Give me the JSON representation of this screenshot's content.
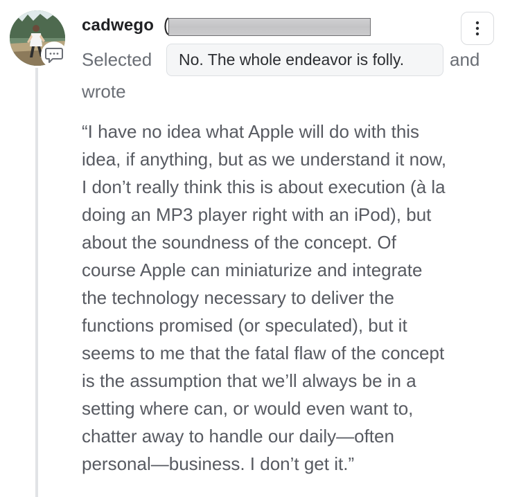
{
  "comment": {
    "username": "cadwego",
    "selected_prefix": "Selected",
    "selected_option": "No. The whole endeavor is folly.",
    "and_text": "and",
    "wrote_text": "wrote",
    "quote_lines": [
      "“I have no idea what Apple will do with this",
      "idea, if anything, but as we understand it now,",
      "I don’t really think this is about execution (à la",
      "doing an MP3 player right with an iPod), but",
      "about the soundness of the concept. Of",
      "course Apple can miniaturize and integrate",
      "the technology necessary to deliver the",
      "functions promised (or speculated), but it",
      "seems to me that the fatal flaw of the concept",
      "is the assumption that we’ll always be in a",
      "setting where can, or would even want to,",
      "chatter away to handle our daily—often",
      "personal—business. I don’t get it.”"
    ]
  },
  "icons": {
    "avatar": "user-photo",
    "badge": "comment-bubble-icon",
    "more": "more-vertical-icon"
  },
  "colors": {
    "username": "#202124",
    "muted_text": "#6a6e75",
    "chip_bg": "#f5f6f7",
    "thread_line": "#e1e3e6",
    "redaction": "#c8c8ca"
  }
}
